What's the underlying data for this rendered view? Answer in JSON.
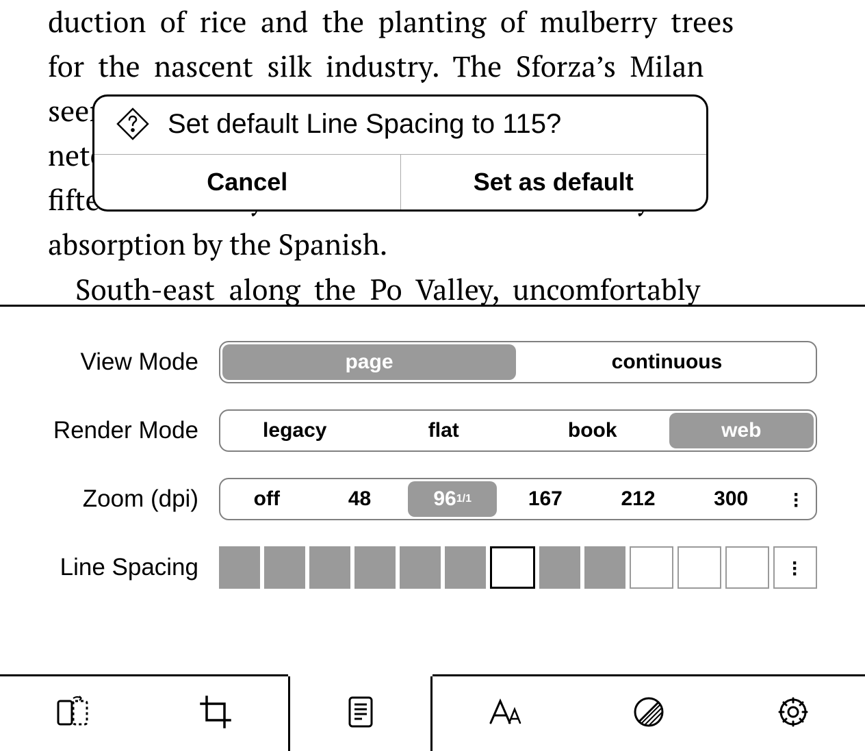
{
  "reader": {
    "line1": "duction  of  rice  and  the  planting  of  mulberry  trees",
    "line2": "for  the  nascent  silk  industry.  The  Sforza’s  Milan",
    "line3": "seemed like a worthy successor, rather than a ni-",
    "line4": "neteenth incarnation of a name. It terminated late",
    "line5": "fifteenth century with the invasion and the city’s",
    "line6": "absorption by the Spanish.",
    "line7": "South-east  along  the  Po  Valley,  uncomfortably"
  },
  "dialog": {
    "title": "Set default Line Spacing to 115?",
    "cancel": "Cancel",
    "confirm": "Set as default"
  },
  "settings": {
    "view_mode": {
      "label": "View Mode",
      "options": [
        "page",
        "continuous"
      ],
      "selected": 0
    },
    "render_mode": {
      "label": "Render Mode",
      "options": [
        "legacy",
        "flat",
        "book",
        "web"
      ],
      "selected": 3
    },
    "zoom": {
      "label": "Zoom (dpi)",
      "options": [
        "off",
        "48",
        "96",
        "167",
        "212",
        "300"
      ],
      "selected": 2,
      "selected_sup": "1/1"
    },
    "line_spacing": {
      "label": "Line Spacing",
      "filled": 9,
      "current": 6,
      "total": 12
    }
  },
  "tabs": {
    "items": [
      "rotation",
      "crop",
      "document",
      "font",
      "contrast",
      "settings"
    ],
    "active": 2
  }
}
